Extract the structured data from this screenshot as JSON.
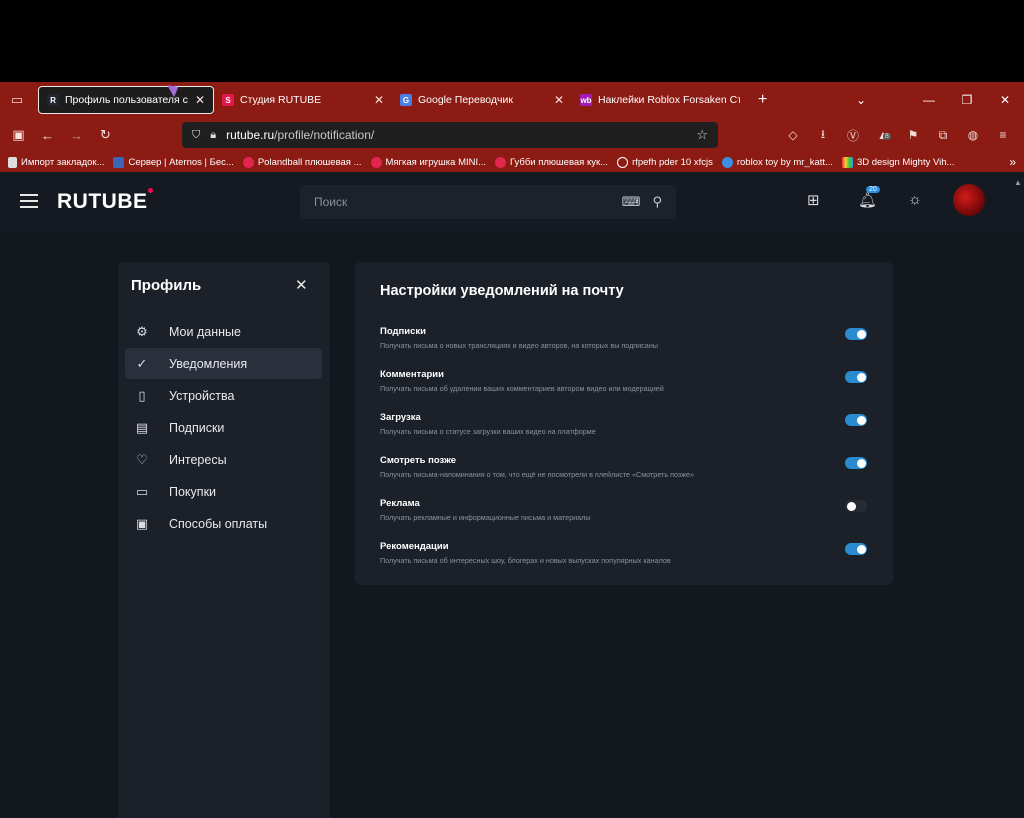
{
  "browser": {
    "tabs": [
      {
        "title": "Профиль пользователя с"
      },
      {
        "title": "Студия RUTUBE"
      },
      {
        "title": "Google Переводчик"
      },
      {
        "title": "Наклейки Roblox Forsaken Ст"
      }
    ],
    "url_host": "rutube.ru",
    "url_path": "/profile/notification/",
    "bookmarks": [
      "Импорт закладок...",
      "Сервер | Aternos | Бес...",
      "Polandball плюшевая ...",
      "Мягкая игрушка MINI...",
      "Губби плюшевая кук...",
      "rfpefh pder 10 xfcjs",
      "roblox toy by mr_katt...",
      "3D design Mighty Vih..."
    ],
    "ext_badge": "8"
  },
  "header": {
    "logo": "RUTUBE",
    "search_placeholder": "Поиск",
    "notif_badge": "20"
  },
  "sidebar": {
    "title": "Профиль",
    "items": [
      {
        "label": "Мои данные",
        "icon": "gear-icon"
      },
      {
        "label": "Уведомления",
        "icon": "check-icon"
      },
      {
        "label": "Устройства",
        "icon": "phone-icon"
      },
      {
        "label": "Подписки",
        "icon": "subscriptions-icon"
      },
      {
        "label": "Интересы",
        "icon": "heart-icon"
      },
      {
        "label": "Покупки",
        "icon": "wallet-icon"
      },
      {
        "label": "Способы оплаты",
        "icon": "card-icon"
      }
    ]
  },
  "panel": {
    "title": "Настройки уведомлений на почту",
    "options": [
      {
        "title": "Подписки",
        "desc": "Получать письма о новых трансляциях и видео авторов, на которых вы подписаны",
        "on": true
      },
      {
        "title": "Комментарии",
        "desc": "Получать письма об удалении ваших комментариев автором видео или модерацией",
        "on": true
      },
      {
        "title": "Загрузка",
        "desc": "Получать письма о статусе загрузки ваших видео на платформе",
        "on": true
      },
      {
        "title": "Смотреть позже",
        "desc": "Получать письма-напоминания о том, что ещё не посмотрели в плейлисте «Смотреть позже»",
        "on": true
      },
      {
        "title": "Реклама",
        "desc": "Получать рекламные и информационные письма и материалы",
        "on": false
      },
      {
        "title": "Рекомендации",
        "desc": "Получать письма об интересных шоу, блогерах и новых выпусках популярных каналов",
        "on": true
      }
    ]
  },
  "colors": {
    "accent": "#2b8bd1",
    "browser_chrome": "#8c1b13",
    "bg": "#13171e",
    "card": "#1b2029"
  }
}
